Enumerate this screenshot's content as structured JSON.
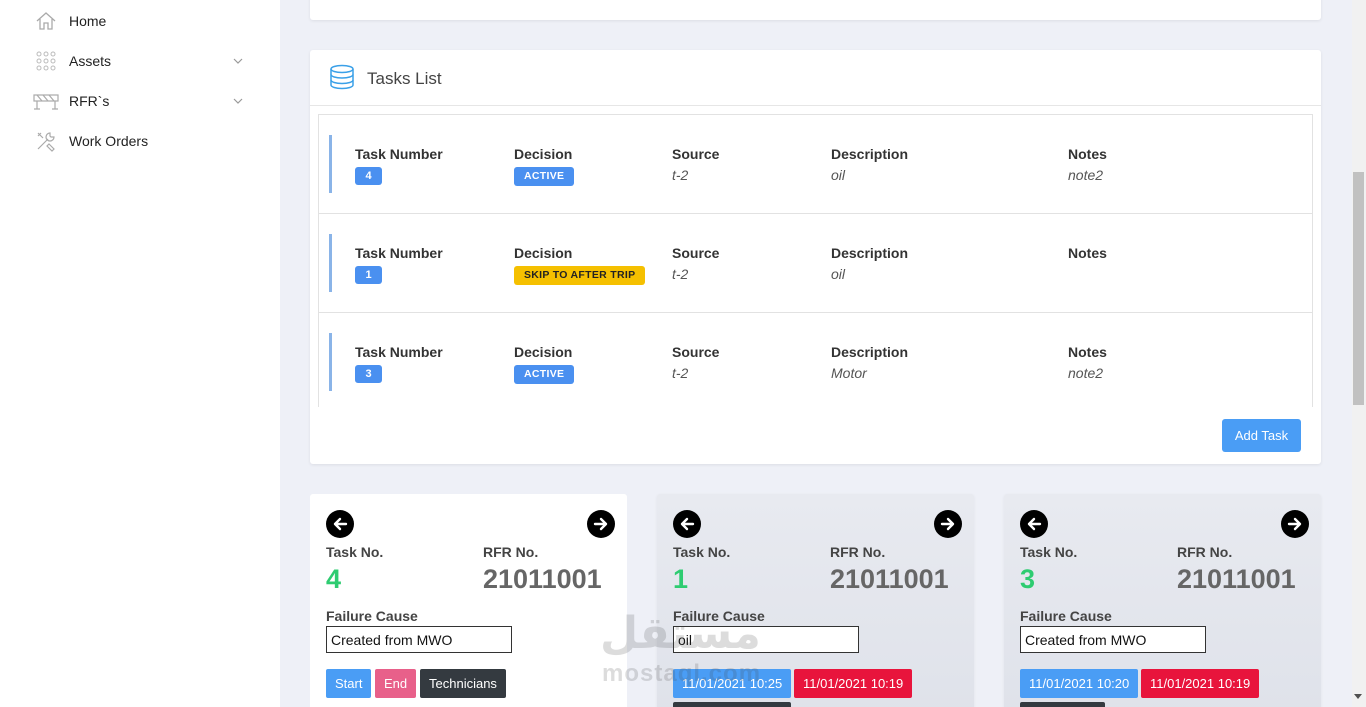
{
  "sidebar": {
    "items": [
      {
        "label": "Home",
        "icon": "home-icon"
      },
      {
        "label": "Assets",
        "icon": "grid-dots-icon"
      },
      {
        "label": "RFR`s",
        "icon": "barrier-icon"
      },
      {
        "label": "Work Orders",
        "icon": "tools-icon"
      }
    ]
  },
  "tasks_list": {
    "title": "Tasks List",
    "headers": {
      "task_number": "Task Number",
      "decision": "Decision",
      "source": "Source",
      "description": "Description",
      "notes": "Notes"
    },
    "rows": [
      {
        "task_number": "4",
        "decision": "ACTIVE",
        "decision_color": "#4a90f0",
        "source": "t-2",
        "description": "oil",
        "notes": "note2"
      },
      {
        "task_number": "1",
        "decision": "SKIP TO AFTER TRIP",
        "decision_color": "#f5c000",
        "source": "t-2",
        "description": "oil",
        "notes": ""
      },
      {
        "task_number": "3",
        "decision": "ACTIVE",
        "decision_color": "#4a90f0",
        "source": "t-2",
        "description": "Motor",
        "notes": "note2"
      }
    ],
    "add_task_label": "Add Task"
  },
  "cards_labels": {
    "task_no": "Task No.",
    "rfr_no": "RFR No.",
    "failure_cause": "Failure Cause"
  },
  "cards": [
    {
      "task_no": "4",
      "rfr_no": "21011001",
      "failure_cause": "Created from MWO",
      "start_label": "Start",
      "end_label": "End",
      "technicians_label": "Technicians"
    },
    {
      "task_no": "1",
      "rfr_no": "21011001",
      "failure_cause": "oil",
      "start_time": "11/01/2021 10:25",
      "end_time": "11/01/2021 10:19"
    },
    {
      "task_no": "3",
      "rfr_no": "21011001",
      "failure_cause": "Created from MWO",
      "start_time": "11/01/2021 10:20",
      "end_time": "11/01/2021 10:19"
    }
  ],
  "watermark": {
    "arabic": "مستقل",
    "latin": "mostaql.com"
  },
  "colors": {
    "accent": "#4a9df5",
    "task_no_green": "#2ecc71",
    "end_red": "#e8143c",
    "badge_yellow": "#f5c000"
  }
}
